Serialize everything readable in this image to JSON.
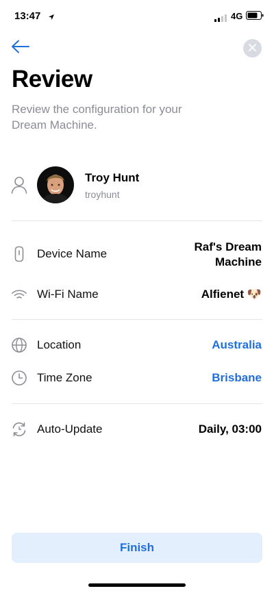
{
  "status_bar": {
    "time": "13:47",
    "network": "4G"
  },
  "header": {
    "title": "Review",
    "subtitle": "Review the configuration for your Dream Machine."
  },
  "user": {
    "name": "Troy Hunt",
    "handle": "troyhunt"
  },
  "settings": [
    {
      "label": "Device Name",
      "value": "Raf's Dream Machine",
      "icon": "device-icon"
    },
    {
      "label": "Wi-Fi Name",
      "value": "Alfienet",
      "emoji": "🐶",
      "icon": "wifi-icon"
    },
    {
      "label": "Location",
      "value": "Australia",
      "icon": "globe-icon",
      "color": "#1f6fde"
    },
    {
      "label": "Time Zone",
      "value": "Brisbane",
      "icon": "clock-icon",
      "color": "#1f6fde"
    },
    {
      "label": "Auto-Update",
      "value": "Daily, 03:00",
      "icon": "auto-update-icon"
    }
  ],
  "actions": {
    "finish_label": "Finish"
  },
  "colors": {
    "accent": "#1f6fde",
    "button_bg": "#e3effc",
    "muted": "#8a8d94"
  }
}
